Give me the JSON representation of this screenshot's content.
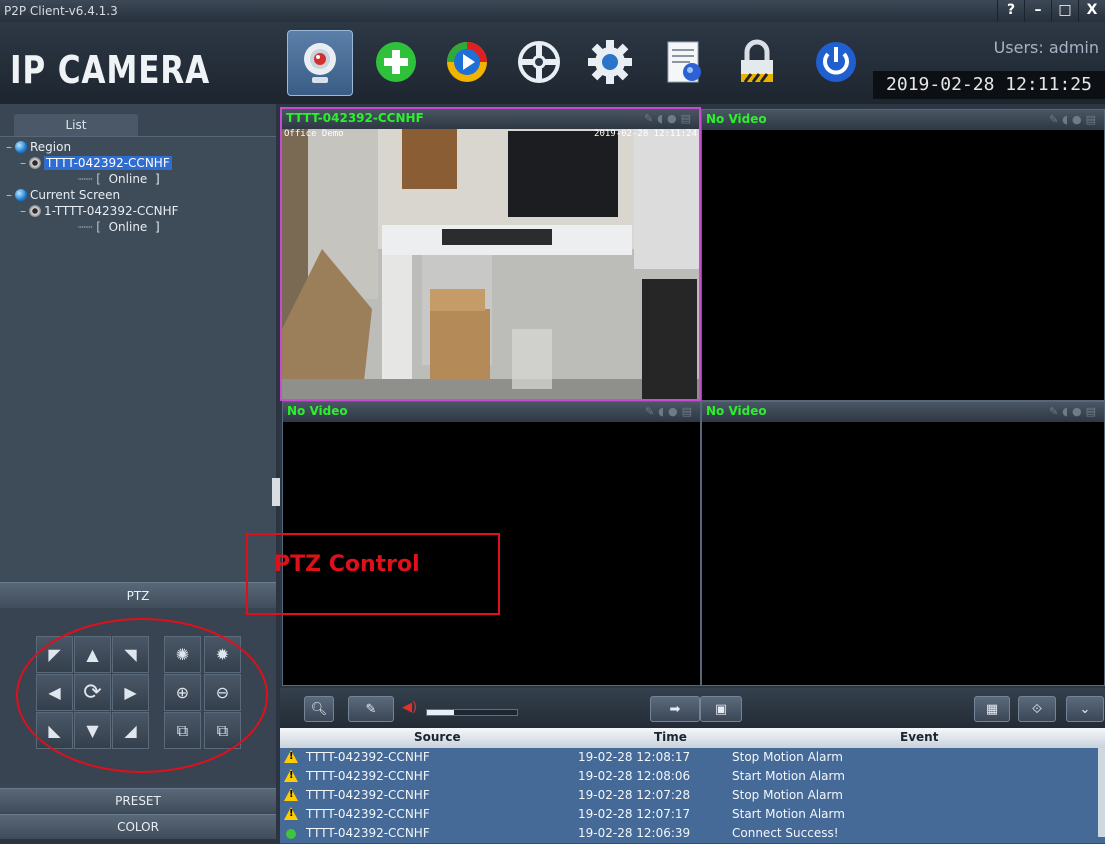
{
  "window": {
    "title": "P2P Client-v6.4.1.3",
    "controls": [
      "?",
      "–",
      "□",
      "X"
    ]
  },
  "header": {
    "logo": "IP CAMERA",
    "users": "Users: admin",
    "clock": "2019-02-28 12:11:25",
    "toolbar_icons": [
      "webcam-icon",
      "add-icon",
      "playback-icon",
      "ptz-wheel-icon",
      "settings-gear-icon",
      "log-document-icon",
      "lock-icon",
      "power-icon"
    ]
  },
  "left": {
    "list_tab": "List",
    "tree": [
      {
        "prefix": "–",
        "label": "Region"
      },
      {
        "prefix": "–",
        "label": "TTTT-042392-CCNHF"
      },
      {
        "prefix": "┈┈ [",
        "label": "Online",
        "suffix": "]"
      },
      {
        "prefix": "–",
        "label": "Current Screen"
      },
      {
        "prefix": "–",
        "label": "1-TTTT-042392-CCNHF"
      },
      {
        "prefix": "┈┈ [",
        "label": "Online",
        "suffix": "]"
      }
    ],
    "ptz_label": "PTZ",
    "preset_label": "PRESET",
    "color_label": "COLOR"
  },
  "annotation": {
    "ptz_control": "PTZ Control",
    "color": "#e0101a"
  },
  "panes": [
    {
      "title": "TTTT-042392-CCNHF",
      "overlay_left": "Office Demo",
      "overlay_right": "2019-02-28 12:11:24"
    },
    {
      "title": "No Video"
    },
    {
      "title": "No Video"
    },
    {
      "title": "No Video"
    }
  ],
  "events": {
    "headers": [
      "Source",
      "Time",
      "Event"
    ],
    "rows": [
      {
        "icon": "warning-icon",
        "source": "TTTT-042392-CCNHF",
        "time": "19-02-28 12:08:17",
        "event": "Stop Motion Alarm"
      },
      {
        "icon": "warning-icon",
        "source": "TTTT-042392-CCNHF",
        "time": "19-02-28 12:08:06",
        "event": "Start Motion Alarm"
      },
      {
        "icon": "warning-icon",
        "source": "TTTT-042392-CCNHF",
        "time": "19-02-28 12:07:28",
        "event": "Stop Motion Alarm"
      },
      {
        "icon": "warning-icon",
        "source": "TTTT-042392-CCNHF",
        "time": "19-02-28 12:07:17",
        "event": "Start Motion Alarm"
      },
      {
        "icon": "online-dot-icon",
        "source": "TTTT-042392-CCNHF",
        "time": "19-02-28 12:06:39",
        "event": "Connect Success!"
      }
    ]
  },
  "colors": {
    "accent_green": "#2df02d",
    "active_pane": "#c84cd1",
    "row_blue": "#456a97"
  }
}
